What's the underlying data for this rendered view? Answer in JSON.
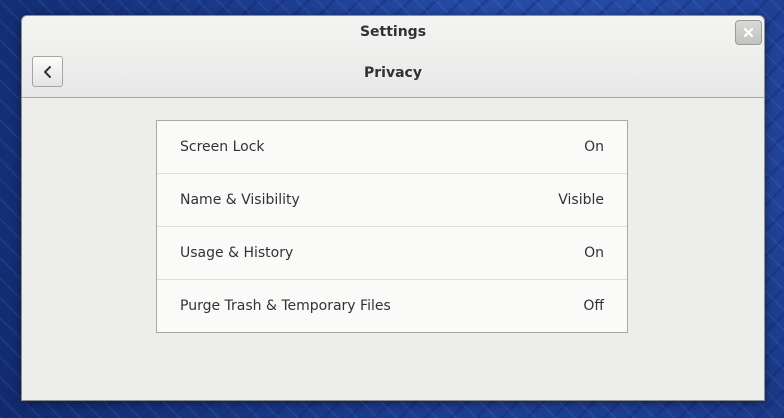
{
  "window": {
    "app_title": "Settings",
    "page_title": "Privacy"
  },
  "header": {
    "back_icon": "chevron-left-icon",
    "close_icon": "close-icon"
  },
  "privacy": {
    "items": [
      {
        "label": "Screen Lock",
        "value": "On"
      },
      {
        "label": "Name & Visibility",
        "value": "Visible"
      },
      {
        "label": "Usage & History",
        "value": "On"
      },
      {
        "label": "Purge Trash & Temporary Files",
        "value": "Off"
      }
    ]
  },
  "colors": {
    "desktop_background": "#1f3f8f",
    "window_background": "#ededec",
    "text": "#2e3436"
  }
}
